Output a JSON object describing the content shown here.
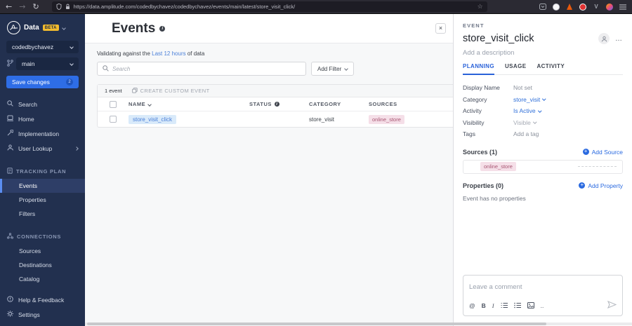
{
  "browser": {
    "url": "https://data.amplitude.com/codedbychavez/codedbychavez/events/main/latest/store_visit_click/"
  },
  "icons": {
    "back": "←",
    "forward": "→",
    "reload": "↻",
    "star": "☆",
    "close": "×",
    "more": "…",
    "extension_v": "V",
    "at": "@",
    "bold": "B",
    "italic": "I",
    "toolbar_more": "..",
    "info": "i",
    "plus": "+"
  },
  "sidebar": {
    "product": "Data",
    "beta": "BETA",
    "workspace": "codedbychavez",
    "branch": "main",
    "save": {
      "label": "Save changes",
      "badge": "2"
    },
    "nav": [
      {
        "label": "Search"
      },
      {
        "label": "Home"
      },
      {
        "label": "Implementation"
      },
      {
        "label": "User Lookup"
      }
    ],
    "sections": [
      {
        "title": "TRACKING PLAN",
        "items": [
          {
            "label": "Events",
            "active": true
          },
          {
            "label": "Properties"
          },
          {
            "label": "Filters"
          }
        ]
      },
      {
        "title": "CONNECTIONS",
        "items": [
          {
            "label": "Sources"
          },
          {
            "label": "Destinations"
          },
          {
            "label": "Catalog"
          }
        ]
      }
    ],
    "footer": [
      {
        "label": "Help & Feedback"
      },
      {
        "label": "Settings"
      }
    ]
  },
  "main": {
    "title": "Events",
    "validating": {
      "prefix": "Validating against the",
      "link": "Last 12 hours",
      "suffix": "of data"
    },
    "search_placeholder": "Search",
    "add_filter_label": "Add Filter",
    "toolbar": {
      "count": "1 event",
      "create_custom_event": "CREATE CUSTOM EVENT"
    },
    "table": {
      "headers": {
        "name": "NAME",
        "status": "STATUS",
        "category": "CATEGORY",
        "sources": "SOURCES"
      },
      "row": {
        "name": "store_visit_click",
        "category": "store_visit",
        "source": "online_store"
      }
    }
  },
  "panel": {
    "kicker": "EVENT",
    "title": "store_visit_click",
    "description_placeholder": "Add a description",
    "tabs": [
      {
        "label": "PLANNING",
        "active": true
      },
      {
        "label": "USAGE"
      },
      {
        "label": "ACTIVITY"
      }
    ],
    "fields": {
      "display_name": {
        "label": "Display Name",
        "value": "Not set"
      },
      "category": {
        "label": "Category",
        "value": "store_visit"
      },
      "activity": {
        "label": "Activity",
        "value": "Is Active"
      },
      "visibility": {
        "label": "Visibility",
        "value": "Visible"
      },
      "tags": {
        "label": "Tags",
        "value": "Add a tag"
      }
    },
    "sources": {
      "title": "Sources (1)",
      "action": "Add Source",
      "chip": "online_store"
    },
    "properties": {
      "title": "Properties (0)",
      "action": "Add Property",
      "empty": "Event has no properties"
    },
    "comment": {
      "placeholder": "Leave a comment"
    }
  },
  "colors": {
    "sidebar_bg": "#22304f",
    "sidebar_box": "#1a2742",
    "save_blue": "#2e6de6",
    "accent_blue": "#2a62d9",
    "link_blue": "#4c80d9",
    "beta_yellow": "#f3bc2e",
    "chip_pink_bg": "#f5dfe8",
    "chip_pink_text": "#a85673",
    "name_pill_bg": "#d9eafa",
    "main_bg": "#f7f8f9"
  }
}
